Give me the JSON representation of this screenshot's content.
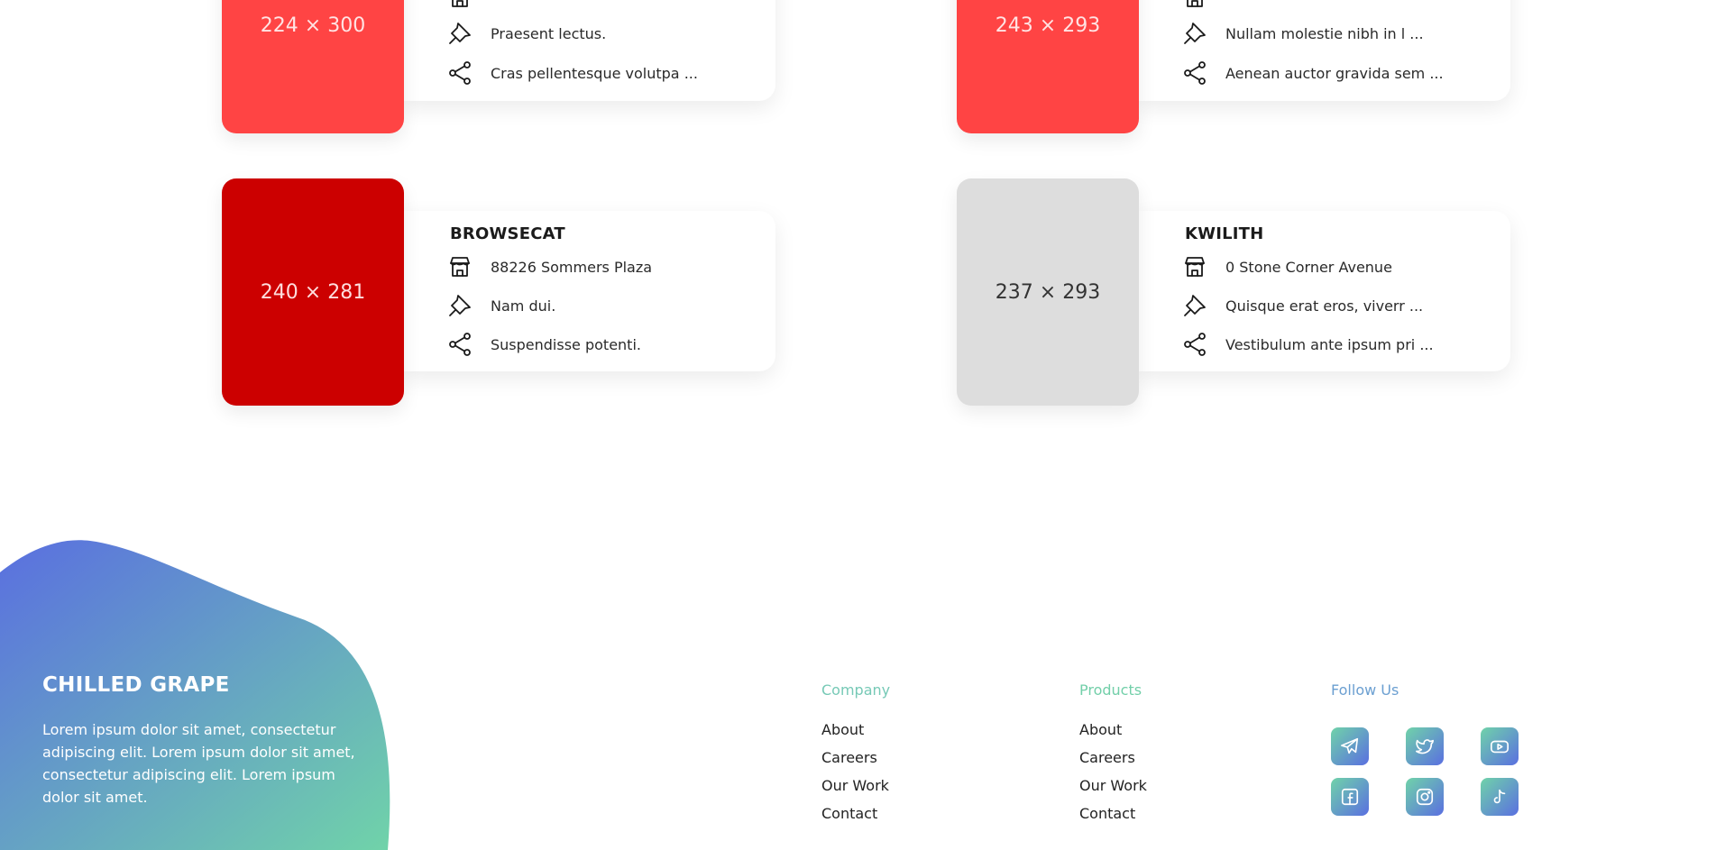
{
  "cards": [
    {
      "name": "",
      "placeholder": "224 × 300",
      "address": "",
      "pin": "Praesent lectus.",
      "share": "Cras pellentesque volutpa ...",
      "color": "#ff4444",
      "text_color": "#ffe3e3"
    },
    {
      "name": "",
      "placeholder": "243 × 293",
      "address": "",
      "pin": "Nullam molestie nibh in l ...",
      "share": "Aenean auctor gravida sem ...",
      "color": "#ff4444",
      "text_color": "#ffe3e3"
    },
    {
      "name": "BROWSECAT",
      "placeholder": "240 × 281",
      "address": "88226 Sommers Plaza",
      "pin": "Nam dui.",
      "share": "Suspendisse potenti.",
      "color": "#cc0000",
      "text_color": "#ffdede"
    },
    {
      "name": "KWILITH",
      "placeholder": "237 × 293",
      "address": "0 Stone Corner Avenue",
      "pin": "Quisque erat eros, viverr ...",
      "share": "Vestibulum ante ipsum pri ...",
      "color": "#dddddd",
      "text_color": "#333333"
    }
  ],
  "footer": {
    "brand": "CHILLED GRAPE",
    "description": "Lorem ipsum dolor sit amet, consectetur adipiscing elit. Lorem ipsum dolor sit amet, consectetur adipiscing elit. Lorem ipsum dolor sit amet.",
    "company": {
      "title": "Company",
      "links": [
        "About",
        "Careers",
        "Our Work",
        "Contact"
      ]
    },
    "products": {
      "title": "Products",
      "links": [
        "About",
        "Careers",
        "Our Work",
        "Contact"
      ]
    },
    "follow": {
      "title": "Follow Us",
      "icons": [
        "telegram-icon",
        "twitter-icon",
        "youtube-icon",
        "facebook-icon",
        "instagram-icon",
        "tiktok-icon"
      ]
    },
    "gradient": [
      "#5a6fe0",
      "#70d3a9"
    ]
  }
}
